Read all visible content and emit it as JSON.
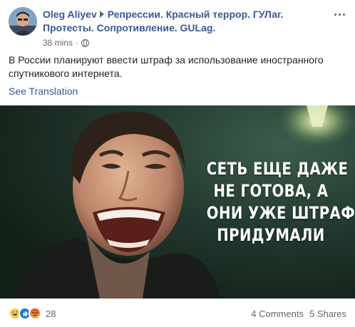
{
  "post": {
    "author": "Oleg Aliyev",
    "group": "Репрессии. Красный террор. ГУЛаг. Протесты. Сопротивление. GULag.",
    "time": "38 mins",
    "separator": "·",
    "privacy_icon": "globe-icon",
    "text": "В России планируют ввести штраф за использование иностранного спутникового интернета.",
    "see_translation": "See Translation"
  },
  "image": {
    "caption_lines": [
      "СЕТЬ ЕЩЕ ДАЖЕ",
      "НЕ ГОТОВА, А",
      "ОНИ УЖЕ ШТРАФ",
      "ПРИДУМАЛИ"
    ]
  },
  "footer": {
    "reaction_icons": [
      "haha-icon",
      "like-icon",
      "angry-icon"
    ],
    "reaction_count": "28",
    "comments": "4 Comments",
    "shares": "5 Shares"
  },
  "colors": {
    "link": "#385898",
    "meta": "#616770",
    "background_green": "#1f3a30"
  }
}
